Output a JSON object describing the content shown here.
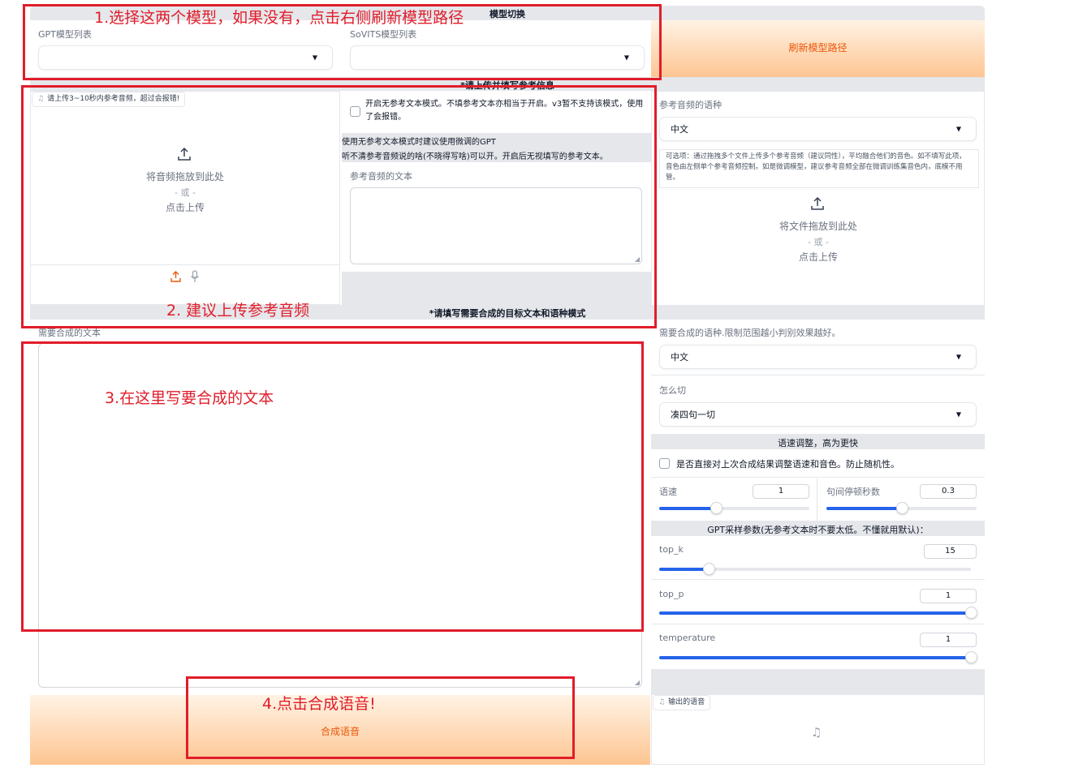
{
  "model_switch": {
    "title": "模型切换",
    "gpt_label": "GPT模型列表",
    "gpt_value": "",
    "sovits_label": "SoVITS模型列表",
    "sovits_value": "",
    "refresh_button": "刷新模型路径"
  },
  "reference": {
    "section_title": "*请上传并填写参考信息",
    "audio_chip": "请上传3~10秒内参考音频，超过会报错!",
    "upload_main": "将音频拖放到此处",
    "upload_or": "- 或 -",
    "upload_click": "点击上传",
    "no_ref_checkbox": "开启无参考文本模式。不填参考文本亦相当于开启。v3暂不支持该模式，使用了会报错。",
    "no_ref_info_1": "使用无参考文本模式时建议使用微调的GPT",
    "no_ref_info_2": "听不清参考音频说的啥(不晓得写啥)可以开。开启后无视填写的参考文本。",
    "ref_text_label": "参考音频的文本",
    "ref_text_value": "",
    "ref_lang_label": "参考音频的语种",
    "ref_lang_value": "中文",
    "multi_ref_info": "可选项：通过拖拽多个文件上传多个参考音频（建议同性），平均融合他们的音色。如不填写此项，音色由左侧单个参考音频控制。如是微调模型，建议参考音频全部在微调训练集音色内，底模不用管。",
    "file_upload_main": "将文件拖放到此处",
    "file_upload_or": "- 或 -",
    "file_upload_click": "点击上传"
  },
  "synthesis": {
    "section_title": "*请填写需要合成的目标文本和语种模式",
    "target_text_label": "需要合成的文本",
    "target_text_value": "",
    "target_lang_label": "需要合成的语种.限制范围越小判别效果越好。",
    "target_lang_value": "中文",
    "cut_label": "怎么切",
    "cut_value": "凑四句一切",
    "speed_section": "语速调整，高为更快",
    "speed_checkbox": "是否直接对上次合成结果调整语速和音色。防止随机性。",
    "speed_label": "语速",
    "speed_value": "1",
    "speed_fraction": 0.38,
    "pause_label": "句间停顿秒数",
    "pause_value": "0.3",
    "pause_fraction": 0.5,
    "gpt_section": "GPT采样参数(无参考文本时不要太低。不懂就用默认)：",
    "top_k_label": "top_k",
    "top_k_value": "15",
    "top_k_fraction": 0.16,
    "top_p_label": "top_p",
    "top_p_value": "1",
    "top_p_fraction": 1.0,
    "temperature_label": "temperature",
    "temperature_value": "1",
    "temperature_fraction": 1.0,
    "synth_button": "合成语音",
    "output_label": "输出的语音"
  },
  "annotations": {
    "step1": "1.选择这两个模型，如果没有，点击右侧刷新模型路径",
    "step2": "2. 建议上传参考音频",
    "step3": "3.在这里写要合成的文本",
    "step4": "4.点击合成语音!"
  },
  "colors": {
    "accent_orange": "#ea580c",
    "slider_blue": "#2563eb",
    "annotation_red": "#e11d2a"
  }
}
